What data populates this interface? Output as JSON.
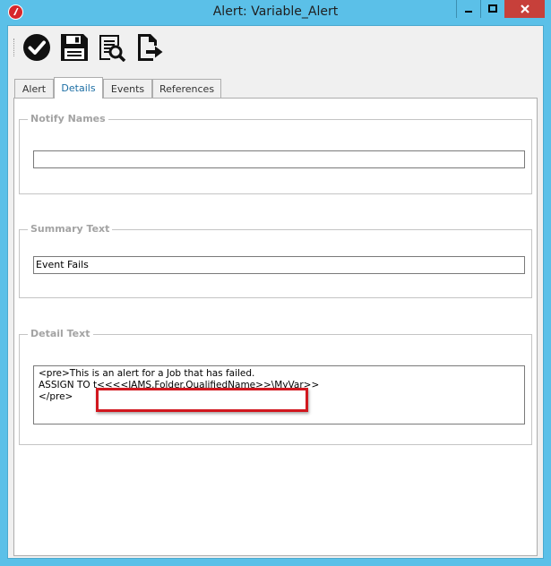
{
  "window": {
    "title": "Alert: Variable_Alert",
    "controls": {
      "minimize": "minimize",
      "maximize": "maximize",
      "close": "close"
    }
  },
  "toolbar": {
    "buttons": [
      {
        "name": "save-and-close",
        "icon": "check-circle-icon"
      },
      {
        "name": "save",
        "icon": "floppy-disk-icon"
      },
      {
        "name": "preview",
        "icon": "document-search-icon"
      },
      {
        "name": "export",
        "icon": "document-export-icon"
      }
    ]
  },
  "tabs": [
    {
      "label": "Alert",
      "active": false
    },
    {
      "label": "Details",
      "active": true
    },
    {
      "label": "Events",
      "active": false
    },
    {
      "label": "References",
      "active": false
    }
  ],
  "groups": {
    "notify_names": {
      "label": "Notify Names",
      "value": ""
    },
    "summary_text": {
      "label": "Summary Text",
      "value": "Event Fails"
    },
    "detail_text": {
      "label": "Detail Text",
      "lines": [
        "<pre>This is an alert for a Job that has failed.",
        "",
        "ASSIGN TO t<<<<JAMS.Folder.QualifiedName>>\\MyVar>>",
        "</pre>"
      ]
    }
  },
  "colors": {
    "titlebar": "#5bc0e8",
    "close_button": "#c7403a",
    "active_tab_text": "#1c6ea4",
    "highlight_border": "#d1181f"
  }
}
